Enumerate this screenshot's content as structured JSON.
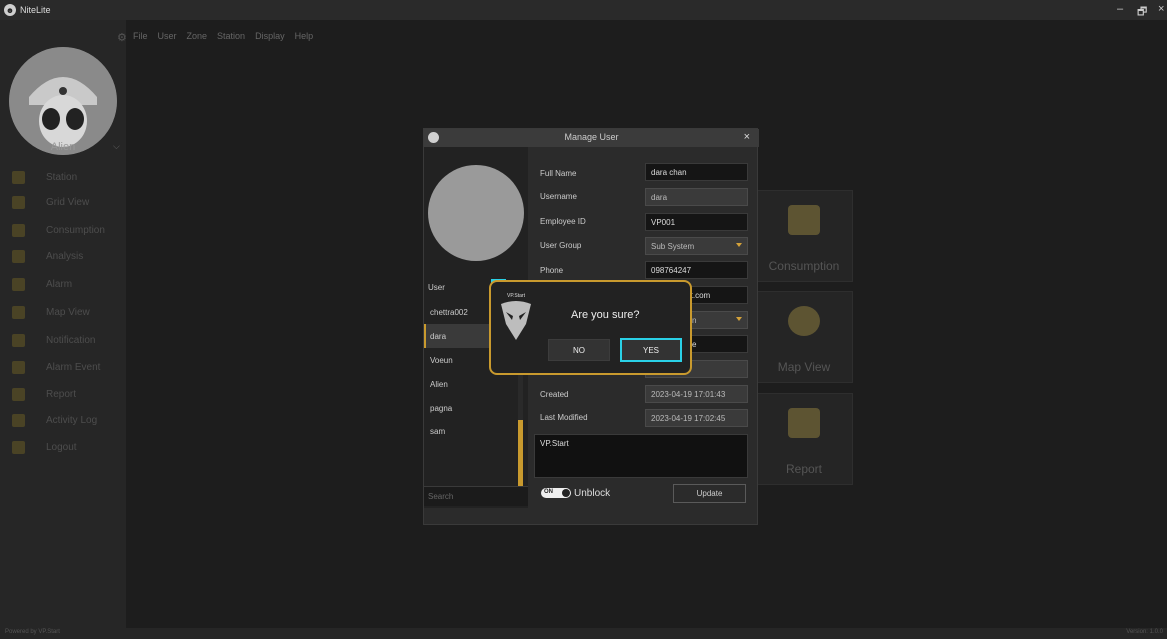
{
  "window": {
    "title": "NiteLite",
    "controls": [
      "–",
      "🗗",
      "×"
    ]
  },
  "menu": [
    "File",
    "User",
    "Zone",
    "Station",
    "Display",
    "Help"
  ],
  "sidebar": {
    "user_name": "Alien",
    "items": [
      {
        "label": "Station",
        "icon": "station-icon"
      },
      {
        "label": "Grid View",
        "icon": "grid-view-icon"
      },
      {
        "label": "Consumption",
        "icon": "consumption-icon"
      },
      {
        "label": "Analysis",
        "icon": "analysis-icon"
      },
      {
        "label": "Alarm",
        "icon": "alarm-icon"
      },
      {
        "label": "Map View",
        "icon": "map-icon"
      },
      {
        "label": "Notification",
        "icon": "notification-icon"
      },
      {
        "label": "Alarm Event",
        "icon": "alarm-event-icon"
      },
      {
        "label": "Report",
        "icon": "report-icon"
      },
      {
        "label": "Activity Log",
        "icon": "activity-log-icon"
      },
      {
        "label": "Logout",
        "icon": "logout-icon"
      }
    ]
  },
  "tiles": [
    {
      "label": "Consumption",
      "icon": "consumption-icon"
    },
    {
      "label": "Map View",
      "icon": "map-icon"
    },
    {
      "label": "Report",
      "icon": "report-icon"
    }
  ],
  "manage_user": {
    "title": "Manage User",
    "close": "×",
    "list_header": "User",
    "remove": "−",
    "add": "+",
    "users": [
      "chettra002",
      "dara",
      "Voeun",
      "Alien",
      "pagna",
      "sam"
    ],
    "selected_user": "dara",
    "search_placeholder": "Search",
    "fields": {
      "full_name": {
        "label": "Full Name",
        "value": "dara chan"
      },
      "username": {
        "label": "Username",
        "value": "dara"
      },
      "employee_id": {
        "label": "Employee ID",
        "value": "VP001"
      },
      "user_group": {
        "label": "User Group",
        "value": "Sub System"
      },
      "phone": {
        "label": "Phone",
        "value": "098764247"
      },
      "email_partial": "rt.com",
      "row7_partial": "n",
      "row8_partial": "e",
      "created": {
        "label": "Created",
        "value": "2023-04-19 17:01:43"
      },
      "last_modified": {
        "label": "Last Modified",
        "value": "2023-04-19 17:02:45"
      }
    },
    "notes": "VP.Start",
    "toggle_text": "ON",
    "unblock_label": "Unblock",
    "update_label": "Update"
  },
  "confirm": {
    "logo_text": "VP.Start",
    "message": "Are you sure?",
    "no_label": "NO",
    "yes_label": "YES"
  },
  "footer": {
    "left": "Powered by VP.Start",
    "right": "Version: 1.0.0"
  },
  "colors": {
    "accent": "#c99a2e",
    "highlight": "#2ad1e6",
    "background": "#1d1d1d"
  }
}
